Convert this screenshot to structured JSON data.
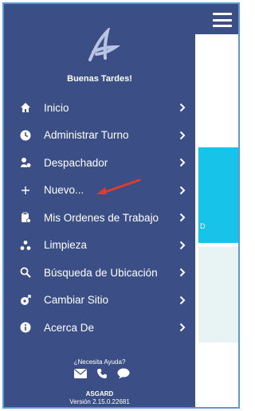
{
  "drawer": {
    "greeting": "Buenas Tardes!",
    "menu": [
      {
        "label": "Inicio",
        "icon": "home-icon"
      },
      {
        "label": "Administrar Turno",
        "icon": "clock-icon"
      },
      {
        "label": "Despachador",
        "icon": "dispatcher-icon"
      },
      {
        "label": "Nuevo...",
        "icon": "plus-icon"
      },
      {
        "label": "Mis Ordenes de Trabajo",
        "icon": "clipboard-icon"
      },
      {
        "label": "Limpieza",
        "icon": "cleaning-icon"
      },
      {
        "label": "Búsqueda de Ubicación",
        "icon": "search-icon"
      },
      {
        "label": "Cambiar Sitio",
        "icon": "change-site-icon"
      },
      {
        "label": "Acerca De",
        "icon": "info-icon"
      }
    ],
    "help": {
      "label": "¿Necesita Ayuda?",
      "icons": [
        "envelope-icon",
        "phone-icon",
        "chat-icon"
      ]
    },
    "app_name": "ASGARD",
    "version": "Versión 2.15.0.22681"
  },
  "background": {
    "strip_text": "D"
  },
  "colors": {
    "drawer_bg": "#3b4f86",
    "accent_cyan": "#18c3ea",
    "annotation_arrow": "#e03b2b"
  }
}
